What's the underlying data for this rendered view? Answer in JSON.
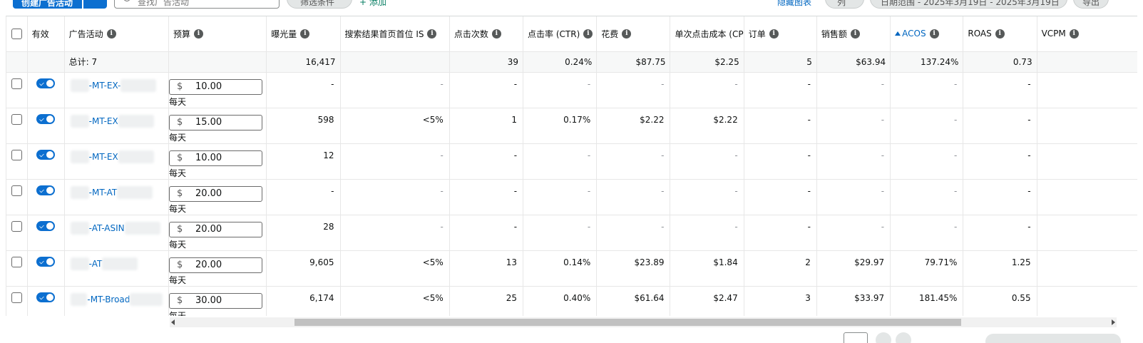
{
  "toolbar": {
    "create_label": "创建广告活动",
    "search_placeholder": "查找广告活动",
    "filter_label": "筛选条件",
    "add_filter_label": "+ 添加",
    "hide_chart_label": "隐藏图表",
    "period_label": "列",
    "date_range_label": "日期范围 - 2025年3月19日 - 2025年3月19日",
    "export_label": "导出"
  },
  "columns": {
    "enabled": "有效",
    "campaign": "广告活动",
    "budget": "预算",
    "impressions": "曝光量",
    "top_is": "搜索结果首页首位 IS",
    "clicks": "点击次数",
    "ctr": "点击率 (CTR)",
    "spend": "花费",
    "cpc": "单次点击成本 (CPC)",
    "orders": "订单",
    "sales": "销售额",
    "acos": "ACOS",
    "roas": "ROAS",
    "vcpm": "VCPM"
  },
  "totals": {
    "label": "总计: 7",
    "impressions": "16,417",
    "clicks": "39",
    "ctr": "0.24%",
    "spend": "$87.75",
    "cpc": "$2.25",
    "orders": "5",
    "sales": "$63.94",
    "acos": "137.24%",
    "roas": "0.73"
  },
  "currency": "$",
  "per_day": "每天",
  "rows": [
    {
      "name": "-MT-EX-",
      "budget": "10.00",
      "impressions": "-",
      "top_is": "-",
      "clicks": "-",
      "ctr": "-",
      "spend": "-",
      "cpc": "-",
      "orders": "-",
      "sales": "-",
      "acos": "-",
      "roas": "-"
    },
    {
      "name": "-MT-EX",
      "budget": "15.00",
      "impressions": "598",
      "top_is": "<5%",
      "clicks": "1",
      "ctr": "0.17%",
      "spend": "$2.22",
      "cpc": "$2.22",
      "orders": "-",
      "sales": "-",
      "acos": "-",
      "roas": "-"
    },
    {
      "name": "-MT-EX",
      "budget": "10.00",
      "impressions": "12",
      "top_is": "-",
      "clicks": "-",
      "ctr": "-",
      "spend": "-",
      "cpc": "-",
      "orders": "-",
      "sales": "-",
      "acos": "-",
      "roas": "-"
    },
    {
      "name": "-MT-AT",
      "budget": "20.00",
      "impressions": "-",
      "top_is": "-",
      "clicks": "-",
      "ctr": "-",
      "spend": "-",
      "cpc": "-",
      "orders": "-",
      "sales": "-",
      "acos": "-",
      "roas": "-"
    },
    {
      "name": "-AT-ASIN",
      "budget": "20.00",
      "impressions": "28",
      "top_is": "-",
      "clicks": "-",
      "ctr": "-",
      "spend": "-",
      "cpc": "-",
      "orders": "-",
      "sales": "-",
      "acos": "-",
      "roas": "-"
    },
    {
      "name": "-AT",
      "budget": "20.00",
      "impressions": "9,605",
      "top_is": "<5%",
      "clicks": "13",
      "ctr": "0.14%",
      "spend": "$23.89",
      "cpc": "$1.84",
      "orders": "2",
      "sales": "$29.97",
      "acos": "79.71%",
      "roas": "1.25"
    },
    {
      "name": "-MT-Broad",
      "budget": "30.00",
      "impressions": "6,174",
      "top_is": "<5%",
      "clicks": "25",
      "ctr": "0.40%",
      "spend": "$61.64",
      "cpc": "$2.47",
      "orders": "3",
      "sales": "$33.97",
      "acos": "181.45%",
      "roas": "0.55"
    }
  ],
  "colors": {
    "accent": "#0c6fd0",
    "link": "#0066c0",
    "border": "#e7e7e7",
    "total_row_bg": "#f7f8f8"
  }
}
